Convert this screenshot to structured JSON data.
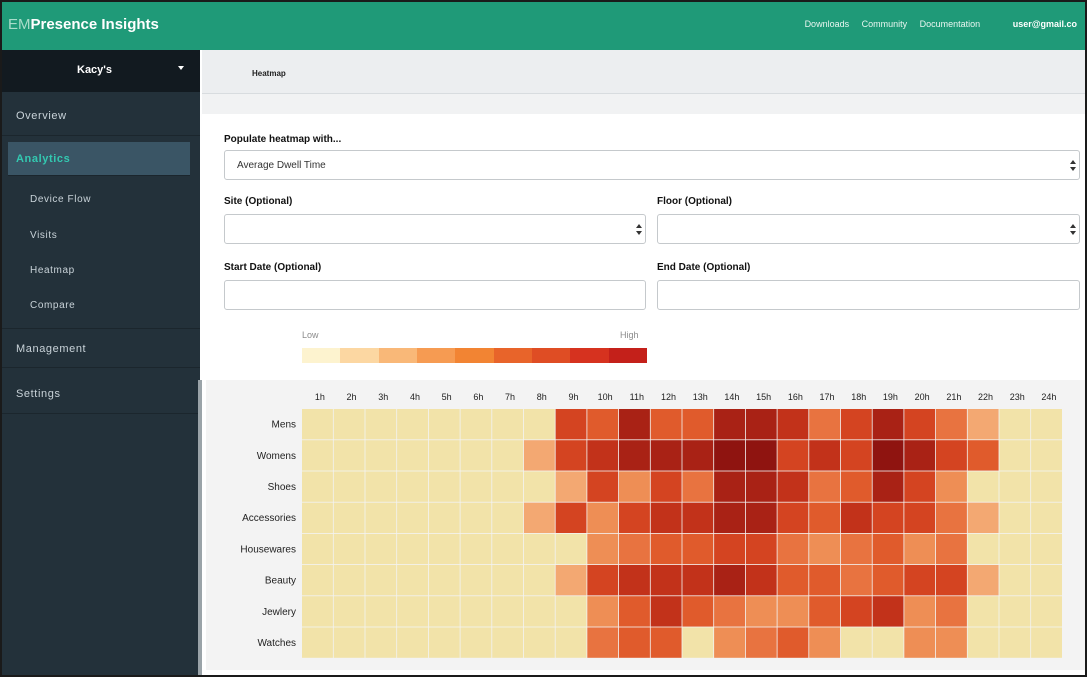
{
  "header": {
    "brand_prefix": "EM",
    "brand_name": "Presence Insights",
    "links": [
      "Downloads",
      "Community",
      "Documentation"
    ],
    "user": "user@gmail.co"
  },
  "sidebar": {
    "org_name": "Kacy's",
    "items": [
      {
        "label": "Overview",
        "level": "top",
        "active": false
      },
      {
        "label": "Analytics",
        "level": "top",
        "active": true
      },
      {
        "label": "Device Flow",
        "level": "sub",
        "active": false
      },
      {
        "label": "Visits",
        "level": "sub",
        "active": false
      },
      {
        "label": "Heatmap",
        "level": "sub",
        "active": false
      },
      {
        "label": "Compare",
        "level": "sub",
        "active": false
      },
      {
        "label": "Management",
        "level": "top",
        "active": false
      },
      {
        "label": "Settings",
        "level": "top",
        "active": false
      }
    ]
  },
  "page": {
    "title": "Heatmap"
  },
  "form": {
    "populate_label": "Populate heatmap with...",
    "populate_value": "Average Dwell Time",
    "site_label": "Site (Optional)",
    "site_value": "",
    "floor_label": "Floor (Optional)",
    "floor_value": "",
    "start_label": "Start Date (Optional)",
    "start_value": "",
    "end_label": "End Date (Optional)",
    "end_value": ""
  },
  "legend": {
    "low": "Low",
    "high": "High",
    "colors": [
      "#fdf3cf",
      "#fcd7a2",
      "#f9b878",
      "#f69b52",
      "#f28433",
      "#e8642a",
      "#df4d24",
      "#d6321f",
      "#c4201a"
    ]
  },
  "colors": {
    "accent": "#1f9a78",
    "active_nav": "#33c9b1",
    "sidebar": "#23313a"
  },
  "chart_data": {
    "type": "heatmap",
    "x": [
      "1h",
      "2h",
      "3h",
      "4h",
      "5h",
      "6h",
      "7h",
      "8h",
      "9h",
      "10h",
      "11h",
      "12h",
      "13h",
      "14h",
      "15h",
      "16h",
      "17h",
      "18h",
      "19h",
      "20h",
      "21h",
      "22h",
      "23h",
      "24h"
    ],
    "y": [
      "Mens",
      "Womens",
      "Shoes",
      "Accessories",
      "Housewares",
      "Beauty",
      "Jewlery",
      "Watches"
    ],
    "scale_min_label": "Low",
    "scale_max_label": "High",
    "values": [
      [
        0,
        0,
        0,
        0,
        0,
        0,
        0,
        0,
        6,
        5,
        8,
        5,
        5,
        8,
        8,
        7,
        4,
        6,
        8,
        6,
        4,
        2,
        0,
        0
      ],
      [
        0,
        0,
        0,
        0,
        0,
        0,
        0,
        2,
        6,
        7,
        8,
        8,
        8,
        9,
        9,
        6,
        7,
        6,
        9,
        8,
        6,
        5,
        0,
        0
      ],
      [
        0,
        0,
        0,
        0,
        0,
        0,
        0,
        0,
        2,
        6,
        3,
        6,
        4,
        8,
        8,
        7,
        4,
        5,
        8,
        6,
        3,
        0,
        0,
        0
      ],
      [
        0,
        0,
        0,
        0,
        0,
        0,
        0,
        2,
        6,
        3,
        6,
        7,
        7,
        8,
        8,
        6,
        5,
        7,
        6,
        6,
        4,
        2,
        0,
        0
      ],
      [
        0,
        0,
        0,
        0,
        0,
        0,
        0,
        0,
        0,
        3,
        4,
        5,
        5,
        6,
        6,
        4,
        3,
        4,
        5,
        3,
        4,
        0,
        0,
        0
      ],
      [
        0,
        0,
        0,
        0,
        0,
        0,
        0,
        0,
        2,
        6,
        7,
        7,
        7,
        8,
        7,
        5,
        5,
        4,
        5,
        6,
        6,
        2,
        0,
        0
      ],
      [
        0,
        0,
        0,
        0,
        0,
        0,
        0,
        0,
        0,
        3,
        5,
        7,
        5,
        4,
        3,
        3,
        5,
        6,
        7,
        3,
        4,
        0,
        0,
        0
      ],
      [
        0,
        0,
        0,
        0,
        0,
        0,
        0,
        0,
        0,
        4,
        5,
        5,
        0,
        3,
        4,
        5,
        3,
        0,
        0,
        3,
        3,
        0,
        0,
        0
      ]
    ]
  }
}
